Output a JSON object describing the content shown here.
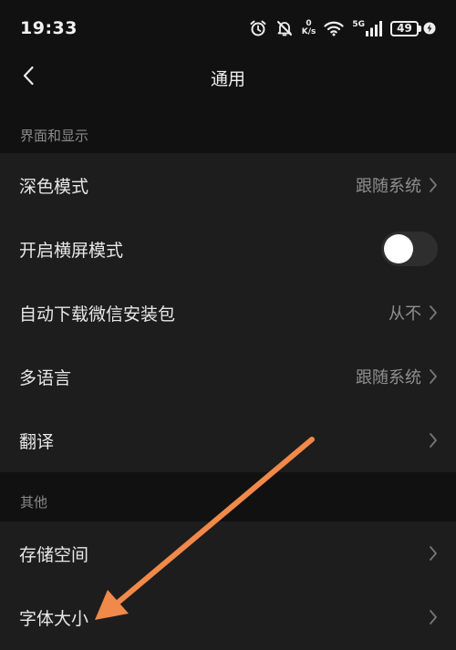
{
  "status_bar": {
    "time": "19:33",
    "net_speed_value": "0",
    "net_speed_unit": "K/s",
    "network_type": "5G",
    "battery_level": "49",
    "icons": [
      "alarm-icon",
      "mute-icon",
      "wifi-icon",
      "signal-icon",
      "charging-icon"
    ]
  },
  "nav": {
    "title": "通用",
    "back_icon": "back-arrow-icon"
  },
  "sections": [
    {
      "header": "界面和显示",
      "items": [
        {
          "label": "深色模式",
          "value": "跟随系统"
        },
        {
          "label": "开启横屏模式",
          "toggle_on": false
        },
        {
          "label": "自动下载微信安装包",
          "value": "从不"
        },
        {
          "label": "多语言",
          "value": "跟随系统"
        },
        {
          "label": "翻译",
          "value": ""
        }
      ]
    },
    {
      "header": "其他",
      "items": [
        {
          "label": "存储空间",
          "value": ""
        },
        {
          "label": "字体大小",
          "value": ""
        }
      ]
    }
  ],
  "annotation": {
    "type": "arrow",
    "color": "#f0894a",
    "points_to": "字体大小"
  },
  "colors": {
    "background": "#111111",
    "list_background": "#1d1d1d",
    "section_header_text": "#8a8a8a",
    "value_text": "#8f8f8f",
    "toggle_off_track": "#2e2e2e"
  }
}
